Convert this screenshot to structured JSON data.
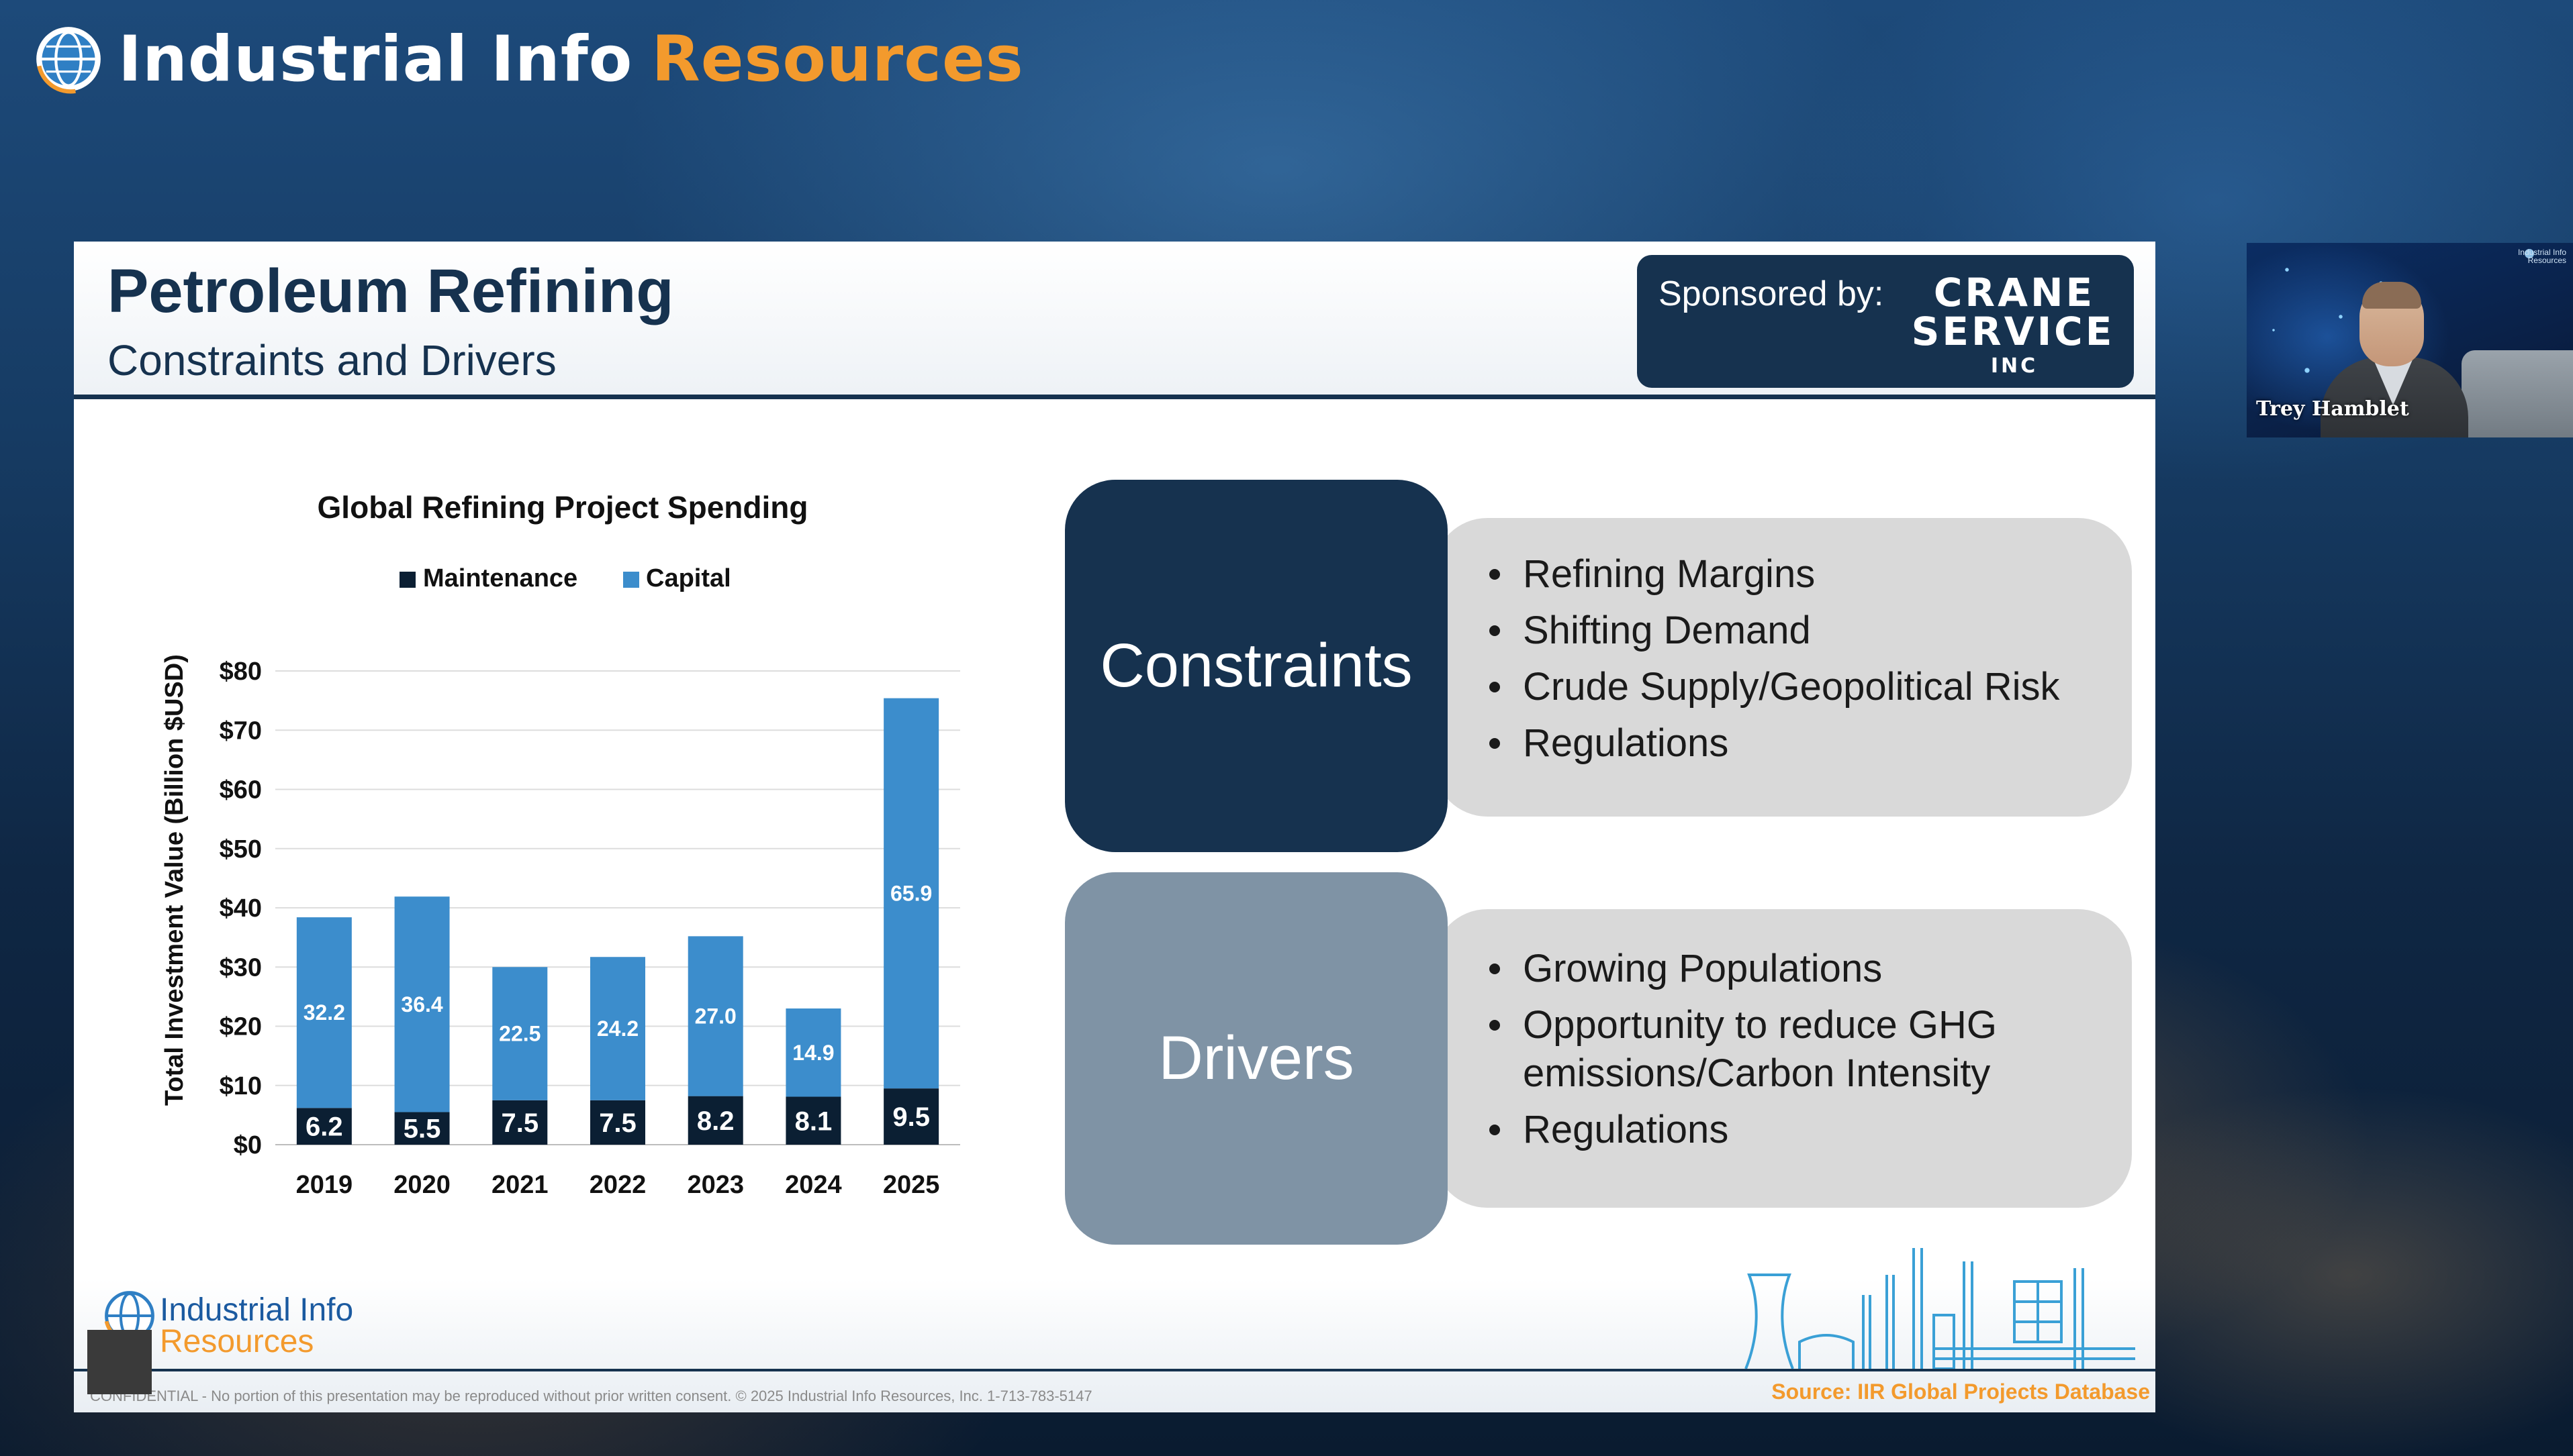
{
  "brand": {
    "name_part1": "Industrial Info",
    "name_part2": "Resources"
  },
  "slide": {
    "title": "Petroleum Refining",
    "subtitle": "Constraints and Drivers",
    "sponsor": {
      "label": "Sponsored by:",
      "line1": "CRANE",
      "line2": "SERVICE",
      "line3": "INC"
    }
  },
  "chart_data": {
    "type": "bar",
    "stacked": true,
    "title": "Global Refining Project Spending",
    "ylabel": "Total Investment Value (Billion $USD)",
    "xlabel": "",
    "categories": [
      "2019",
      "2020",
      "2021",
      "2022",
      "2023",
      "2024",
      "2025"
    ],
    "series": [
      {
        "name": "Maintenance",
        "color": "#0b1f33",
        "values": [
          6.2,
          5.5,
          7.5,
          7.5,
          8.2,
          8.1,
          9.5
        ]
      },
      {
        "name": "Capital",
        "color": "#3c8dcc",
        "values": [
          32.2,
          36.4,
          22.5,
          24.2,
          27.0,
          14.9,
          65.9
        ]
      }
    ],
    "data_labels": {
      "Maintenance": [
        "6.2",
        "5.5",
        "7.5",
        "7.5",
        "8.2",
        "8.1",
        "9.5"
      ],
      "Capital": [
        "32.2",
        "36.4",
        "22.5",
        "24.2",
        "27.0",
        "14.9",
        "65.9"
      ]
    },
    "ylim": [
      0,
      80
    ],
    "yticks": [
      0,
      10,
      20,
      30,
      40,
      50,
      60,
      70,
      80
    ],
    "ytick_labels": [
      "$0",
      "$10",
      "$20",
      "$30",
      "$40",
      "$50",
      "$60",
      "$70",
      "$80"
    ],
    "grid": true,
    "legend_position": "top"
  },
  "constraints": {
    "label": "Constraints",
    "color": "#16324f",
    "items": [
      "Refining Margins",
      "Shifting Demand",
      "Crude Supply/Geopolitical Risk",
      "Regulations"
    ]
  },
  "drivers": {
    "label": "Drivers",
    "color": "#7f93a5",
    "items": [
      "Growing Populations",
      "Opportunity to reduce GHG emissions/Carbon Intensity",
      "Regulations"
    ]
  },
  "footer": {
    "logo_line1": "Industrial Info",
    "logo_line2": "Resources",
    "confidential": "CONFIDENTIAL - No portion of this presentation may be reproduced without prior written consent. © 2025 Industrial Info Resources, Inc. 1-713-783-5147",
    "source": "Source: IIR Global Projects Database"
  },
  "webcam": {
    "participant_name": "Trey Hamblet",
    "watermark_line1": "Industrial Info",
    "watermark_line2": "Resources"
  }
}
